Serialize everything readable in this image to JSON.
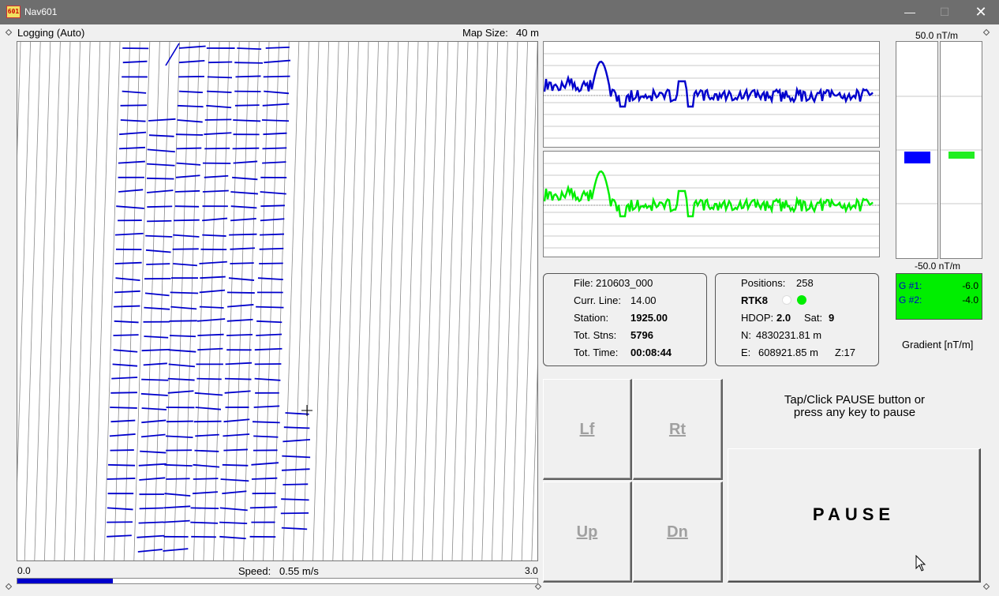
{
  "window": {
    "title": "Nav601",
    "icon_text": "601",
    "minimize": "—",
    "maximize": "☐",
    "close": "✕"
  },
  "map": {
    "status": "Logging (Auto)",
    "size_label": "Map Size:",
    "size_value": "40 m",
    "scale_min": "0.0",
    "scale_max": "3.0",
    "speed_label": "Speed:",
    "speed_value": "0.55 m/s",
    "speed_fraction": 0.183
  },
  "profiles": {
    "series_1_color": "#0000cc",
    "series_2_color": "#00ee00"
  },
  "meters": {
    "top_label": "50.0 nT/m",
    "bottom_label": "-50.0 nT/m",
    "g1_color": "#0000ff",
    "g2_color": "#22ee22"
  },
  "gradient": {
    "g1_label": "G #1:",
    "g1_value": "-6.0",
    "g2_label": "G #2:",
    "g2_value": "-4.0",
    "caption": "Gradient [nT/m]"
  },
  "file_info": {
    "file_label": "File:",
    "file_value": "210603_000",
    "line_label": "Curr. Line:",
    "line_value": "14.00",
    "station_label": "Station:",
    "station_value": "1925.00",
    "stns_label": "Tot. Stns:",
    "stns_value": "5796",
    "time_label": "Tot. Time:",
    "time_value": "00:08:44"
  },
  "position_info": {
    "positions_label": "Positions:",
    "positions_value": "258",
    "rtk_label": "RTK8",
    "hdop_label": "HDOP:",
    "hdop_value": "2.0",
    "sat_label": "Sat:",
    "sat_value": "9",
    "north_label": "N:",
    "north_value": "4830231.81 m",
    "east_label": "E:",
    "east_value": "608921.85 m",
    "zone_label": "Z:17"
  },
  "buttons": {
    "left": "Lf",
    "right": "Rt",
    "up": "Up",
    "down": "Dn",
    "pause": "PAUSE",
    "hint_line1": "Tap/Click PAUSE button or",
    "hint_line2": "press any key to pause"
  }
}
